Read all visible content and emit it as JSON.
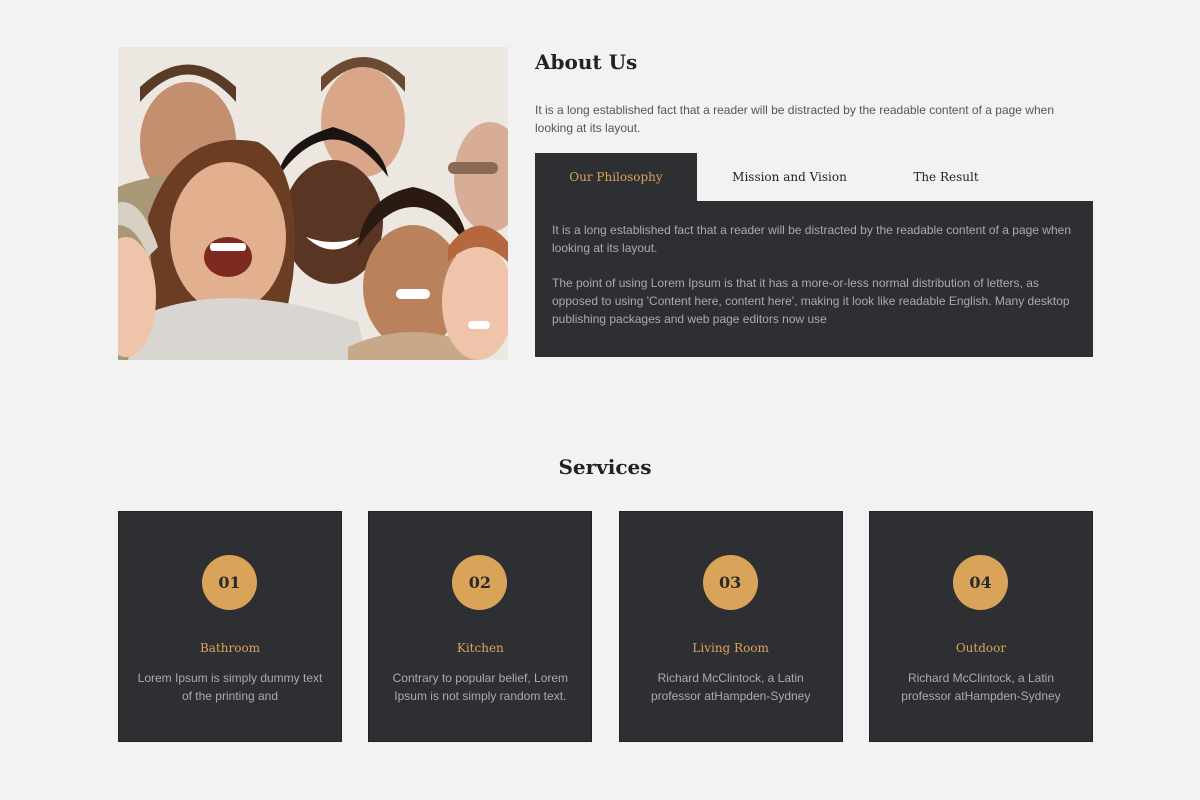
{
  "about": {
    "title": "About Us",
    "description": "It is a long established fact that a reader will be distracted by the readable content of a page when looking at its layout.",
    "tabs": [
      {
        "label": "Our Philosophy"
      },
      {
        "label": "Mission and Vision"
      },
      {
        "label": "The Result"
      }
    ],
    "active_tab": "Our Philosophy",
    "panel": {
      "paragraph1": "It is a long established fact that a reader will be distracted by the readable content of a page when looking at its layout.",
      "paragraph2": "The point of using Lorem Ipsum is that it has a more-or-less normal distribution of letters, as opposed to using 'Content here, content here', making it look like readable English. Many desktop publishing packages and web page editors now use"
    }
  },
  "services": {
    "title": "Services",
    "items": [
      {
        "number": "01",
        "title": "Bathroom",
        "text": "Lorem Ipsum is simply dummy text of the printing and"
      },
      {
        "number": "02",
        "title": "Kitchen",
        "text": "Contrary to popular belief, Lorem Ipsum is not simply random text."
      },
      {
        "number": "03",
        "title": "Living Room",
        "text": "Richard McClintock, a Latin professor atHampden-Sydney"
      },
      {
        "number": "04",
        "title": "Outdoor",
        "text": "Richard McClintock, a Latin professor atHampden-Sydney"
      }
    ]
  },
  "colors": {
    "background": "#f2f2f2",
    "dark_panel": "#2d2f32",
    "accent": "#d9a35a",
    "muted_text": "#a9abad"
  }
}
